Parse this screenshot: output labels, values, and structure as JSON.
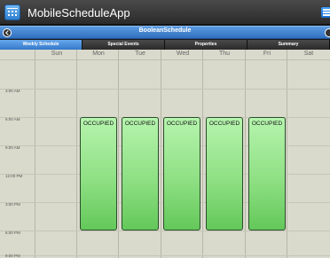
{
  "app": {
    "title": "MobileScheduleApp",
    "logo_icon": "calendar-icon",
    "menu_icon": "menu-icon"
  },
  "view": {
    "title": "BooleanSchedule",
    "back_icon": "back-arrow-icon",
    "forward_icon": "forward-arrow-icon"
  },
  "tabs": [
    {
      "label": "Weekly Schedule",
      "active": true
    },
    {
      "label": "Special Events",
      "active": false
    },
    {
      "label": "Properties",
      "active": false
    },
    {
      "label": "Summary",
      "active": false
    }
  ],
  "days": [
    "Sun",
    "Mon",
    "Tue",
    "Wed",
    "Thu",
    "Fri",
    "Sat"
  ],
  "times": [
    "3:00 AM",
    "6:00 AM",
    "9:00 AM",
    "12:00 PM",
    "3:00 PM",
    "6:00 PM",
    "9:00 PM"
  ],
  "events": [
    {
      "day": "Mon",
      "label": "OCCUPIED"
    },
    {
      "day": "Tue",
      "label": "OCCUPIED"
    },
    {
      "day": "Wed",
      "label": "OCCUPIED"
    },
    {
      "day": "Thu",
      "label": "OCCUPIED"
    },
    {
      "day": "Fri",
      "label": "OCCUPIED"
    }
  ],
  "colors": {
    "header": "#2b2b2b",
    "accent": "#3578c9",
    "calendar_bg": "#d9d9cc",
    "event_fill": "#8fe084"
  }
}
